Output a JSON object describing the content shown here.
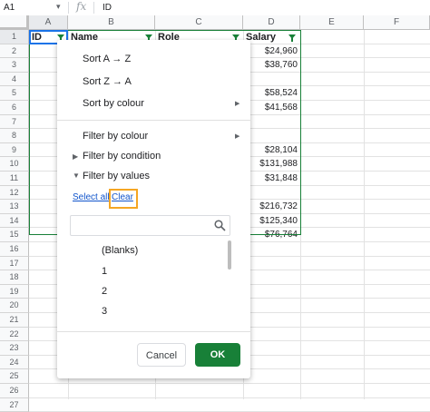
{
  "formula_bar": {
    "cell_ref": "A1",
    "fx": "fx",
    "value": "ID"
  },
  "columns": [
    "A",
    "B",
    "C",
    "D",
    "E",
    "F"
  ],
  "rows": [
    "1",
    "2",
    "3",
    "4",
    "5",
    "6",
    "7",
    "8",
    "9",
    "10",
    "11",
    "12",
    "13",
    "14",
    "15",
    "16",
    "17",
    "18",
    "19",
    "20",
    "21",
    "22",
    "23",
    "24",
    "25",
    "26",
    "27"
  ],
  "headers": {
    "id": "ID",
    "name": "Name",
    "role": "Role",
    "salary": "Salary"
  },
  "salaries": [
    {
      "row": "2",
      "value": "$24,960"
    },
    {
      "row": "3",
      "value": "$38,760"
    },
    {
      "row": "5",
      "value": "$58,524"
    },
    {
      "row": "6",
      "value": "$41,568"
    },
    {
      "row": "9",
      "value": "$28,104"
    },
    {
      "row": "10",
      "value": "$131,988"
    },
    {
      "row": "11",
      "value": "$31,848"
    },
    {
      "row": "13",
      "value": "$216,732"
    },
    {
      "row": "14",
      "value": "$125,340"
    },
    {
      "row": "15",
      "value": "$76,764"
    }
  ],
  "filter_menu": {
    "sort_az": "Sort A → Z",
    "sort_za": "Sort Z → A",
    "sort_colour": "Sort by colour",
    "filter_colour": "Filter by colour",
    "filter_condition": "Filter by condition",
    "filter_values": "Filter by values",
    "select_all": "Select all",
    "clear": "Clear",
    "search_placeholder": "",
    "values": [
      "(Blanks)",
      "1",
      "2",
      "3"
    ],
    "cancel": "Cancel",
    "ok": "OK"
  },
  "colors": {
    "green": "#188038",
    "highlight": "#f5a623",
    "link": "#1155cc"
  }
}
